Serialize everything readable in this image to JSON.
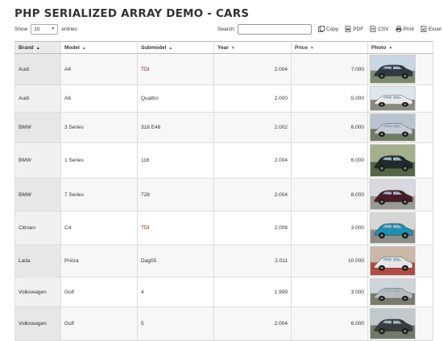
{
  "page": {
    "title": "PHP SERIALIZED ARRAY DEMO - CARS"
  },
  "controls": {
    "show_label": "Show",
    "entries_value": "10",
    "entries_label": "entries",
    "search_label": "Search:",
    "search_value": "",
    "buttons": [
      {
        "label": "Copy",
        "icon": "copy-icon"
      },
      {
        "label": "PDF",
        "icon": "pdf-icon"
      },
      {
        "label": "CSV",
        "icon": "csv-icon"
      },
      {
        "label": "Print",
        "icon": "print-icon"
      },
      {
        "label": "Excel",
        "icon": "excel-icon"
      }
    ]
  },
  "table": {
    "columns": [
      "Brand",
      "Model",
      "Submodel",
      "Year",
      "Price",
      "Photo"
    ],
    "sorted_column": "Brand",
    "rows": [
      {
        "brand": "Audi",
        "model": "A4",
        "submodel": "TDI",
        "year": "2.004",
        "price": "7.000",
        "photo": {
          "body": "#2f3a45",
          "sky": "#c9d6e3",
          "ground": "#7d8a70"
        }
      },
      {
        "brand": "Audi",
        "model": "A6",
        "submodel": "Quattro",
        "year": "2.000",
        "price": "5.000",
        "photo": {
          "body": "#e8e8e8",
          "sky": "#dfe6ec",
          "ground": "#8a8a80"
        }
      },
      {
        "brand": "BMW",
        "model": "3 Series",
        "submodel": "318 E46",
        "year": "2.002",
        "price": "6.000",
        "photo": {
          "body": "#c7ccd2",
          "sky": "#b8c4cf",
          "ground": "#6f7d62"
        }
      },
      {
        "brand": "BMW",
        "model": "1 Series",
        "submodel": "116",
        "year": "2.004",
        "price": "6.000",
        "photo": {
          "body": "#1f2a2c",
          "sky": "#a4b08c",
          "ground": "#556644"
        }
      },
      {
        "brand": "BMW",
        "model": "7 Series",
        "submodel": "728",
        "year": "2.004",
        "price": "8.000",
        "photo": {
          "body": "#4a1e26",
          "sky": "#d7d9de",
          "ground": "#9a9a92"
        }
      },
      {
        "brand": "Citroen",
        "model": "C4",
        "submodel": "TDI",
        "year": "2.008",
        "price": "3.000",
        "photo": {
          "body": "#1e8fb0",
          "sky": "#d6d6d6",
          "ground": "#8e8e86"
        }
      },
      {
        "brand": "Lada",
        "model": "Priora",
        "submodel": "Dag05",
        "year": "2.011",
        "price": "10.000",
        "photo": {
          "body": "#e6e6e6",
          "sky": "#c9b8a8",
          "ground": "#b44b42"
        }
      },
      {
        "brand": "Volkswagen",
        "model": "Golf",
        "submodel": "4",
        "year": "1.999",
        "price": "3.000",
        "photo": {
          "body": "#b9bcbf",
          "sky": "#cfd6da",
          "ground": "#7a7d6e"
        }
      },
      {
        "brand": "Volkswagen",
        "model": "Golf",
        "submodel": "5",
        "year": "2.004",
        "price": "6.000",
        "photo": {
          "body": "#3a3d40",
          "sky": "#c2c8cc",
          "ground": "#707a68"
        }
      }
    ]
  }
}
